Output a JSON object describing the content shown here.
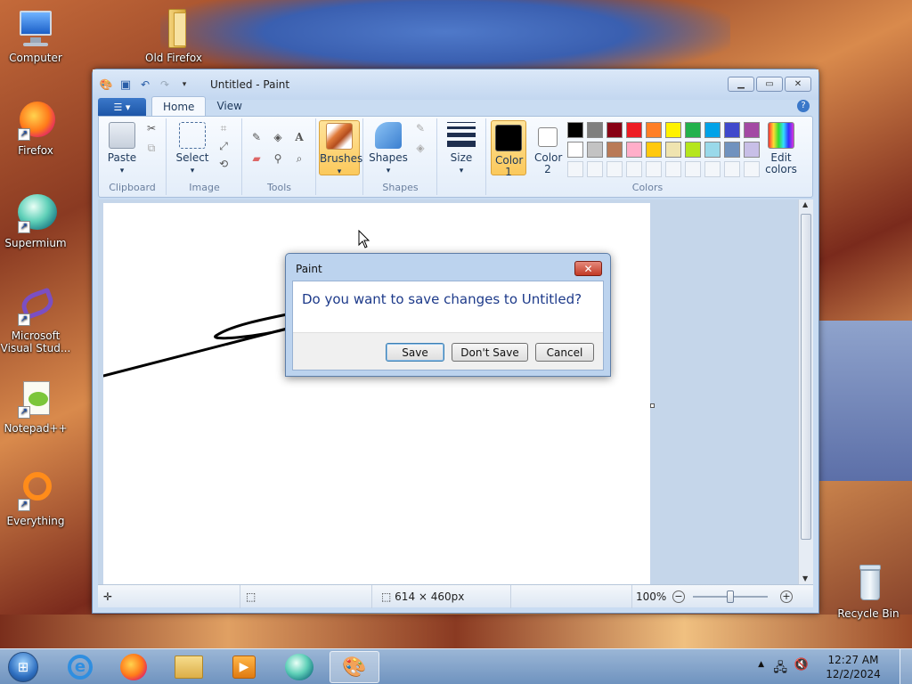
{
  "desktop": {
    "icons": [
      {
        "label": "Computer"
      },
      {
        "label": "Old Firefox"
      },
      {
        "label": "Firefox"
      },
      {
        "label": "Supermium"
      },
      {
        "label": "Microsoft Visual Stud..."
      },
      {
        "label": "Notepad++"
      },
      {
        "label": "Everything"
      },
      {
        "label": "Recycle Bin"
      }
    ]
  },
  "window": {
    "title": "Untitled - Paint",
    "menu_button": "☰ ▾",
    "tabs": [
      {
        "label": "Home"
      },
      {
        "label": "View"
      }
    ],
    "help": "?"
  },
  "ribbon": {
    "groups": {
      "clipboard": {
        "label": "Clipboard",
        "paste": "Paste"
      },
      "image": {
        "label": "Image",
        "select": "Select"
      },
      "tools": {
        "label": "Tools"
      },
      "brushes": {
        "label": "Brushes"
      },
      "shapes": {
        "label": "Shapes",
        "shapes_btn": "Shapes"
      },
      "size": {
        "label": "Size"
      },
      "colors": {
        "label": "Colors",
        "color1": "Color 1",
        "color2": "Color 2",
        "edit": "Edit colors",
        "color1_value": "#000000",
        "color2_value": "#ffffff",
        "palette_row1": [
          "#000000",
          "#7f7f7f",
          "#880015",
          "#ed1c24",
          "#ff7f27",
          "#fff200",
          "#22b14c",
          "#00a2e8",
          "#3f48cc",
          "#a349a4"
        ],
        "palette_row2": [
          "#ffffff",
          "#c3c3c3",
          "#b97a57",
          "#ffaec9",
          "#ffc90e",
          "#efe4b0",
          "#b5e61d",
          "#99d9ea",
          "#7092be",
          "#c8bfe7"
        ]
      }
    }
  },
  "statusbar": {
    "size": "614 × 460px",
    "zoom": "100%"
  },
  "dialog": {
    "title": "Paint",
    "close": "✕",
    "message": "Do you want to save changes to Untitled?",
    "buttons": {
      "save": "Save",
      "dont_save": "Don't Save",
      "cancel": "Cancel"
    }
  },
  "taskbar": {
    "clock_time": "12:27 AM",
    "clock_date": "12/2/2024"
  }
}
